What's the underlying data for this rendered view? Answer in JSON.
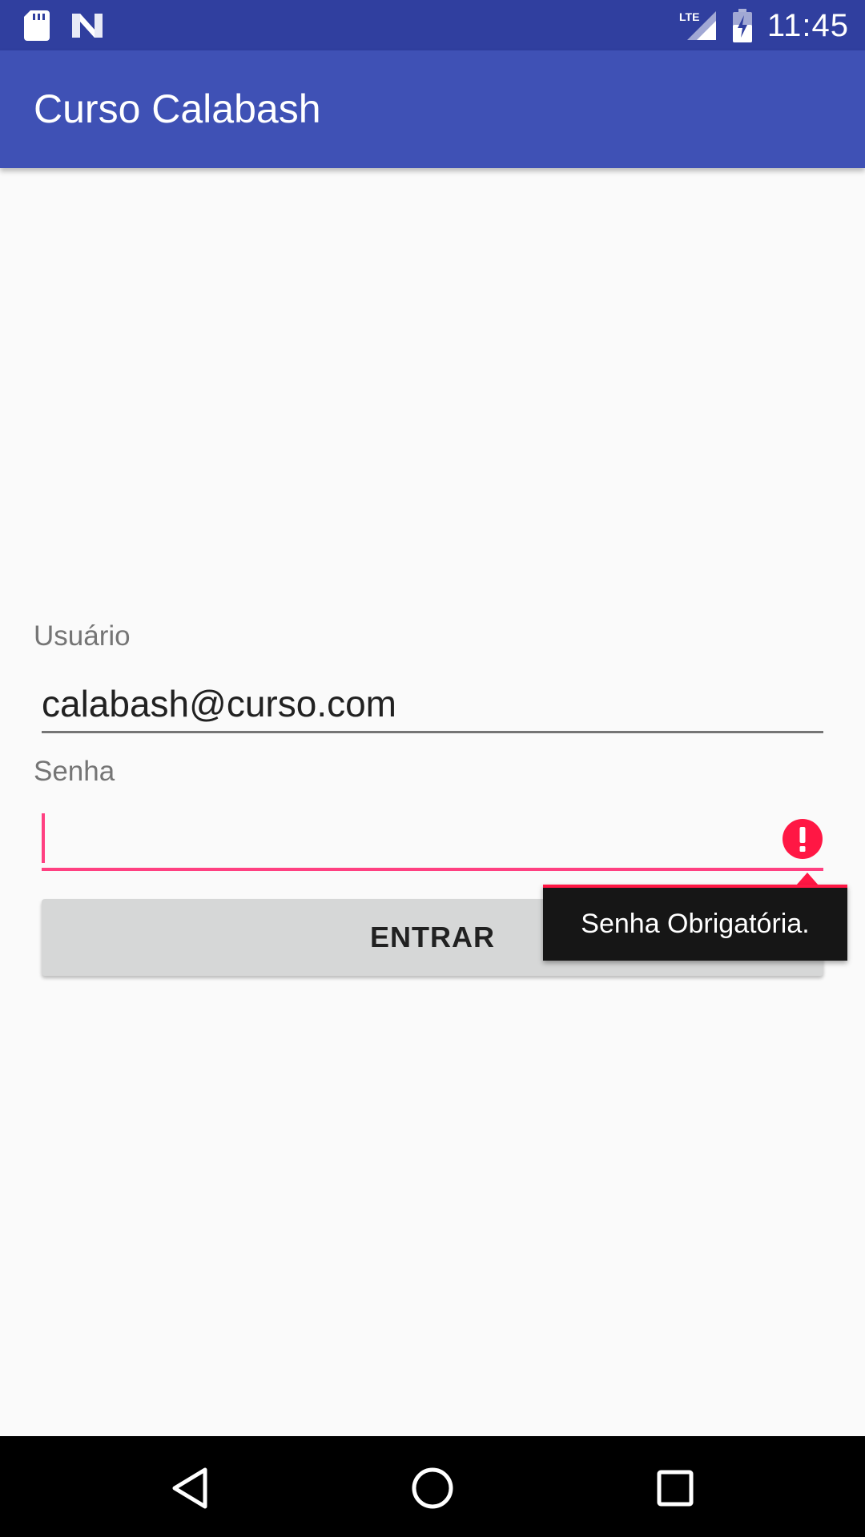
{
  "status_bar": {
    "time": "11:45",
    "network_label": "LTE",
    "icons": [
      "sd-card-icon",
      "n-logo-icon",
      "lte-signal-icon",
      "battery-charging-icon"
    ]
  },
  "app_bar": {
    "title": "Curso Calabash"
  },
  "form": {
    "username": {
      "label": "Usuário",
      "value": "calabash@curso.com"
    },
    "password": {
      "label": "Senha",
      "value": "",
      "error": "Senha Obrigatória."
    },
    "submit_label": "ENTRAR"
  },
  "nav_bar": {
    "buttons": [
      "back-icon",
      "home-icon",
      "recents-icon"
    ]
  },
  "colors": {
    "status_bar": "#303f9f",
    "app_bar": "#3f51b5",
    "accent": "#ff4081",
    "error": "#ff1744",
    "background": "#fafafa",
    "button": "#d6d7d7"
  }
}
